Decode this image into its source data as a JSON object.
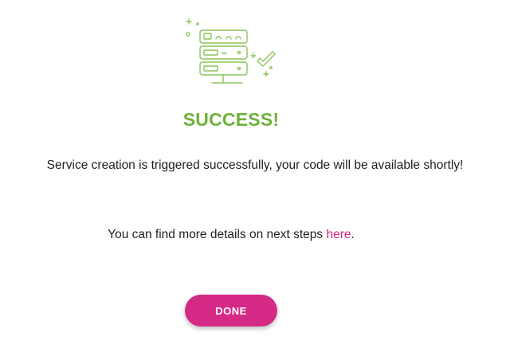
{
  "dialog": {
    "illustration_icon": "server-success-icon",
    "title": "SUCCESS!",
    "message": "Service creation is triggered successfully, your code will be available shortly!",
    "details_prefix": "You can find more details on next steps ",
    "details_link": "here",
    "details_suffix": ".",
    "done_label": "DONE"
  },
  "colors": {
    "success_green": "#6fb13a",
    "accent_pink": "#d42a85",
    "text": "#1f1f1f"
  }
}
